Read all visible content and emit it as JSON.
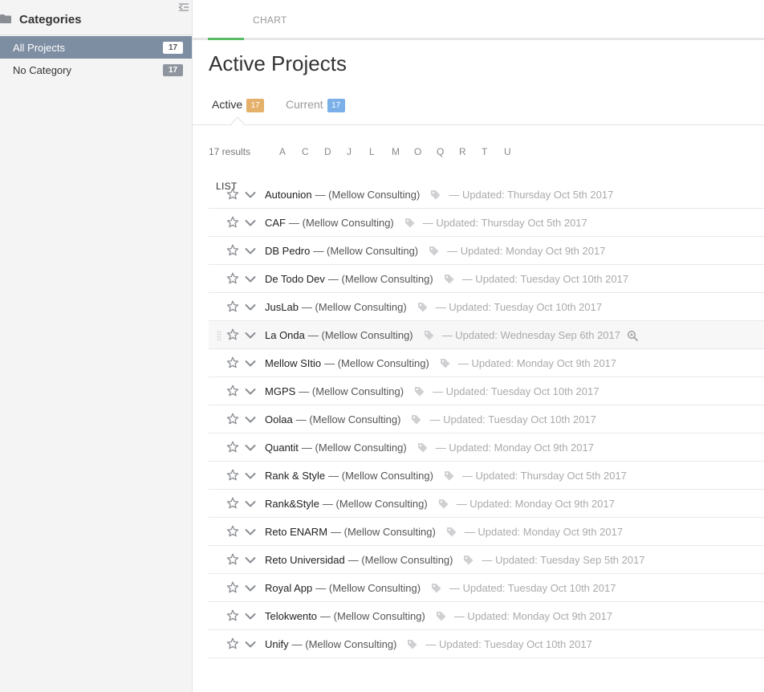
{
  "sidebar": {
    "title": "Categories",
    "items": [
      {
        "label": "All Projects",
        "count": "17"
      },
      {
        "label": "No Category",
        "count": "17"
      }
    ]
  },
  "view_tabs": {
    "list": "LIST",
    "chart": "CHART"
  },
  "page_title": "Active Projects",
  "status_tabs": {
    "active": {
      "label": "Active",
      "count": "17"
    },
    "current": {
      "label": "Current",
      "count": "17"
    }
  },
  "results_text": "17 results",
  "letters": [
    "A",
    "C",
    "D",
    "J",
    "L",
    "M",
    "O",
    "Q",
    "R",
    "T",
    "U"
  ],
  "projects": [
    {
      "name": "Autounion",
      "client": "— (Mellow Consulting)",
      "updated": "— Updated: Thursday Oct 5th 2017"
    },
    {
      "name": "CAF",
      "client": "— (Mellow Consulting)",
      "updated": "— Updated: Thursday Oct 5th 2017"
    },
    {
      "name": "DB Pedro",
      "client": "— (Mellow Consulting)",
      "updated": "— Updated: Monday Oct 9th 2017"
    },
    {
      "name": "De Todo Dev",
      "client": "— (Mellow Consulting)",
      "updated": "— Updated: Tuesday Oct 10th 2017"
    },
    {
      "name": "JusLab",
      "client": "— (Mellow Consulting)",
      "updated": "— Updated: Tuesday Oct 10th 2017"
    },
    {
      "name": "La Onda",
      "client": "— (Mellow Consulting)",
      "updated": "— Updated: Wednesday Sep 6th 2017"
    },
    {
      "name": "Mellow SItio",
      "client": "— (Mellow Consulting)",
      "updated": "— Updated: Monday Oct 9th 2017"
    },
    {
      "name": "MGPS",
      "client": "— (Mellow Consulting)",
      "updated": "— Updated: Tuesday Oct 10th 2017"
    },
    {
      "name": "Oolaa",
      "client": "— (Mellow Consulting)",
      "updated": "— Updated: Tuesday Oct 10th 2017"
    },
    {
      "name": "Quantit",
      "client": "— (Mellow Consulting)",
      "updated": "— Updated: Monday Oct 9th 2017"
    },
    {
      "name": "Rank & Style",
      "client": "— (Mellow Consulting)",
      "updated": "— Updated: Thursday Oct 5th 2017"
    },
    {
      "name": "Rank&Style",
      "client": "— (Mellow Consulting)",
      "updated": "— Updated: Monday Oct 9th 2017"
    },
    {
      "name": "Reto ENARM",
      "client": "— (Mellow Consulting)",
      "updated": "— Updated: Monday Oct 9th 2017"
    },
    {
      "name": "Reto Universidad",
      "client": "— (Mellow Consulting)",
      "updated": "— Updated: Tuesday Sep 5th 2017"
    },
    {
      "name": "Royal App",
      "client": "— (Mellow Consulting)",
      "updated": "— Updated: Tuesday Oct 10th 2017"
    },
    {
      "name": "Telokwento",
      "client": "— (Mellow Consulting)",
      "updated": "— Updated: Monday Oct 9th 2017"
    },
    {
      "name": "Unify",
      "client": "— (Mellow Consulting)",
      "updated": "— Updated: Tuesday Oct 10th 2017"
    }
  ],
  "hovered_project": "La Onda",
  "colors": {
    "sidebar_active": "#7d8da2",
    "tab_underline": "#57bb63",
    "badge_active": "#e5b06a",
    "badge_current": "#7aafe8"
  },
  "icons": [
    "folder-icon",
    "collapse-sidebar-icon",
    "star-icon",
    "chevron-down-icon",
    "tag-icon",
    "magnify-icon",
    "drag-handle-icon"
  ]
}
